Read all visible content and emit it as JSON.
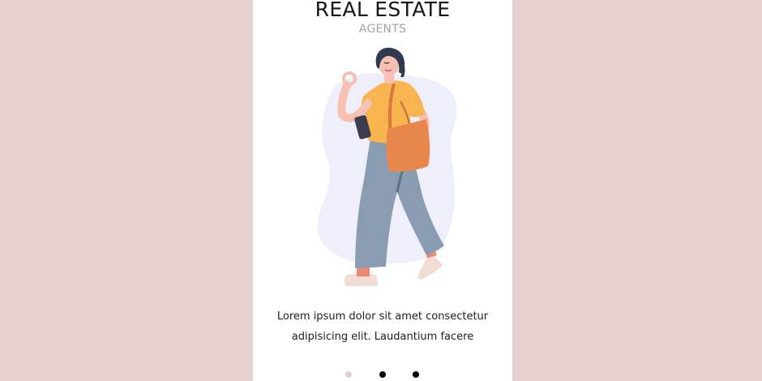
{
  "screen": {
    "title": "REAL ESTATE",
    "subtitle": "AGENTS",
    "illustration": "woman-walking-with-phone-and-bag",
    "description_line1": "Lorem ipsum dolor sit amet consectetur",
    "description_line2": "adipisicing elit. Laudantium facere"
  },
  "pagination": {
    "total": 3,
    "active_index": 0
  },
  "colors": {
    "page_background": "#e8d0d1",
    "card_background": "#ffffff",
    "active_dot": "#e6cdd0",
    "inactive_dot": "#000000"
  }
}
